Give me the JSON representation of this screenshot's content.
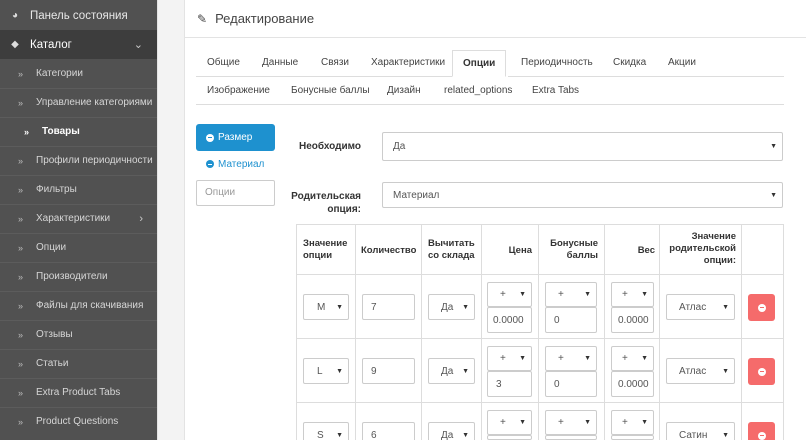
{
  "sidebar": {
    "items": [
      {
        "label": "Панель состояния",
        "icon": "dashboard-icon"
      },
      {
        "label": "Каталог",
        "icon": "tag-icon"
      },
      {
        "label": "Категории"
      },
      {
        "label": "Управление категориями"
      },
      {
        "label": "Товары"
      },
      {
        "label": "Профили периодичности"
      },
      {
        "label": "Фильтры"
      },
      {
        "label": "Характеристики"
      },
      {
        "label": "Опции"
      },
      {
        "label": "Производители"
      },
      {
        "label": "Файлы для скачивания"
      },
      {
        "label": "Отзывы"
      },
      {
        "label": "Статьи"
      },
      {
        "label": "Extra Product Tabs"
      },
      {
        "label": "Product Questions"
      }
    ]
  },
  "panel": {
    "title": "Редактирование"
  },
  "tabs": [
    {
      "label": "Общие"
    },
    {
      "label": "Данные"
    },
    {
      "label": "Связи"
    },
    {
      "label": "Характеристики"
    },
    {
      "label": "Опции"
    },
    {
      "label": "Периодичность"
    },
    {
      "label": "Скидка"
    },
    {
      "label": "Акции"
    },
    {
      "label": "Изображение"
    },
    {
      "label": "Бонусные баллы"
    },
    {
      "label": "Дизайн"
    },
    {
      "label": "related_options"
    },
    {
      "label": "Extra Tabs"
    }
  ],
  "options": {
    "list": [
      {
        "label": "Размер"
      },
      {
        "label": "Материал"
      }
    ],
    "add_placeholder": "Опции"
  },
  "form": {
    "required_label": "Необходимо",
    "required_value": "Да",
    "parent_label_line1": "Родительская",
    "parent_label_line2": "опция:",
    "parent_value": "Материал"
  },
  "table": {
    "headers": {
      "option_value": [
        "Значение",
        "опции"
      ],
      "quantity": [
        "Количество"
      ],
      "subtract": [
        "Вычитать",
        "со склада"
      ],
      "price": [
        "Цена"
      ],
      "points": [
        "Бонусные",
        "баллы"
      ],
      "weight": [
        "Вес"
      ],
      "parent_value": [
        "Значение",
        "родительской",
        "опции:"
      ]
    },
    "rows": [
      {
        "value": "M",
        "quantity": "7",
        "subtract": "Да",
        "price_prefix": "+",
        "price": "0.0000",
        "points_prefix": "+",
        "points": "0",
        "weight_prefix": "+",
        "weight": "0.0000",
        "parent": "Атлас"
      },
      {
        "value": "L",
        "quantity": "9",
        "subtract": "Да",
        "price_prefix": "+",
        "price": "3",
        "points_prefix": "+",
        "points": "0",
        "weight_prefix": "+",
        "weight": "0.0000",
        "parent": "Атлас"
      },
      {
        "value": "S",
        "quantity": "6",
        "subtract": "Да",
        "price_prefix": "+",
        "points_prefix": "+",
        "weight_prefix": "+",
        "parent": "Сатин"
      }
    ]
  }
}
